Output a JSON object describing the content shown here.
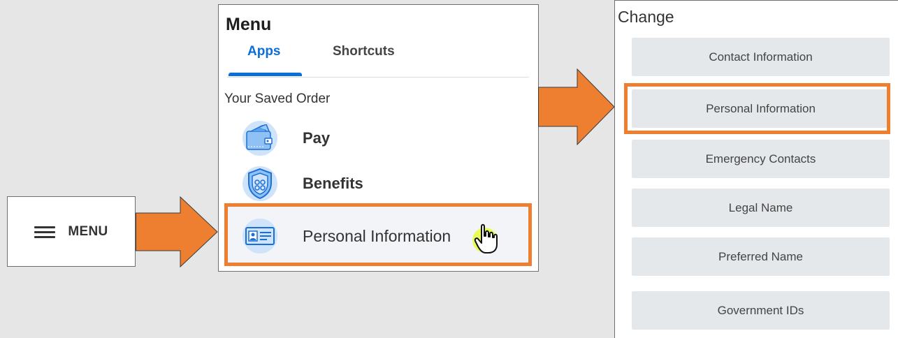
{
  "menu_button": {
    "label": "MENU"
  },
  "menu_panel": {
    "title": "Menu",
    "tabs": [
      {
        "label": "Apps",
        "active": true
      },
      {
        "label": "Shortcuts",
        "active": false
      }
    ],
    "section_label": "Your Saved Order",
    "apps": [
      {
        "label": "Pay",
        "icon": "wallet-icon"
      },
      {
        "label": "Benefits",
        "icon": "shield-icon"
      },
      {
        "label": "Personal Information",
        "icon": "id-card-icon",
        "highlighted": true
      }
    ]
  },
  "change_panel": {
    "title": "Change",
    "buttons": [
      "Contact Information",
      "Personal Information",
      "Emergency Contacts",
      "Legal Name",
      "Preferred Name",
      "Government IDs"
    ]
  },
  "colors": {
    "highlight": "#ee7f31",
    "accent": "#0c6ed8",
    "icon_bg": "#cfe3fb",
    "button_bg": "#e5e8eb"
  }
}
